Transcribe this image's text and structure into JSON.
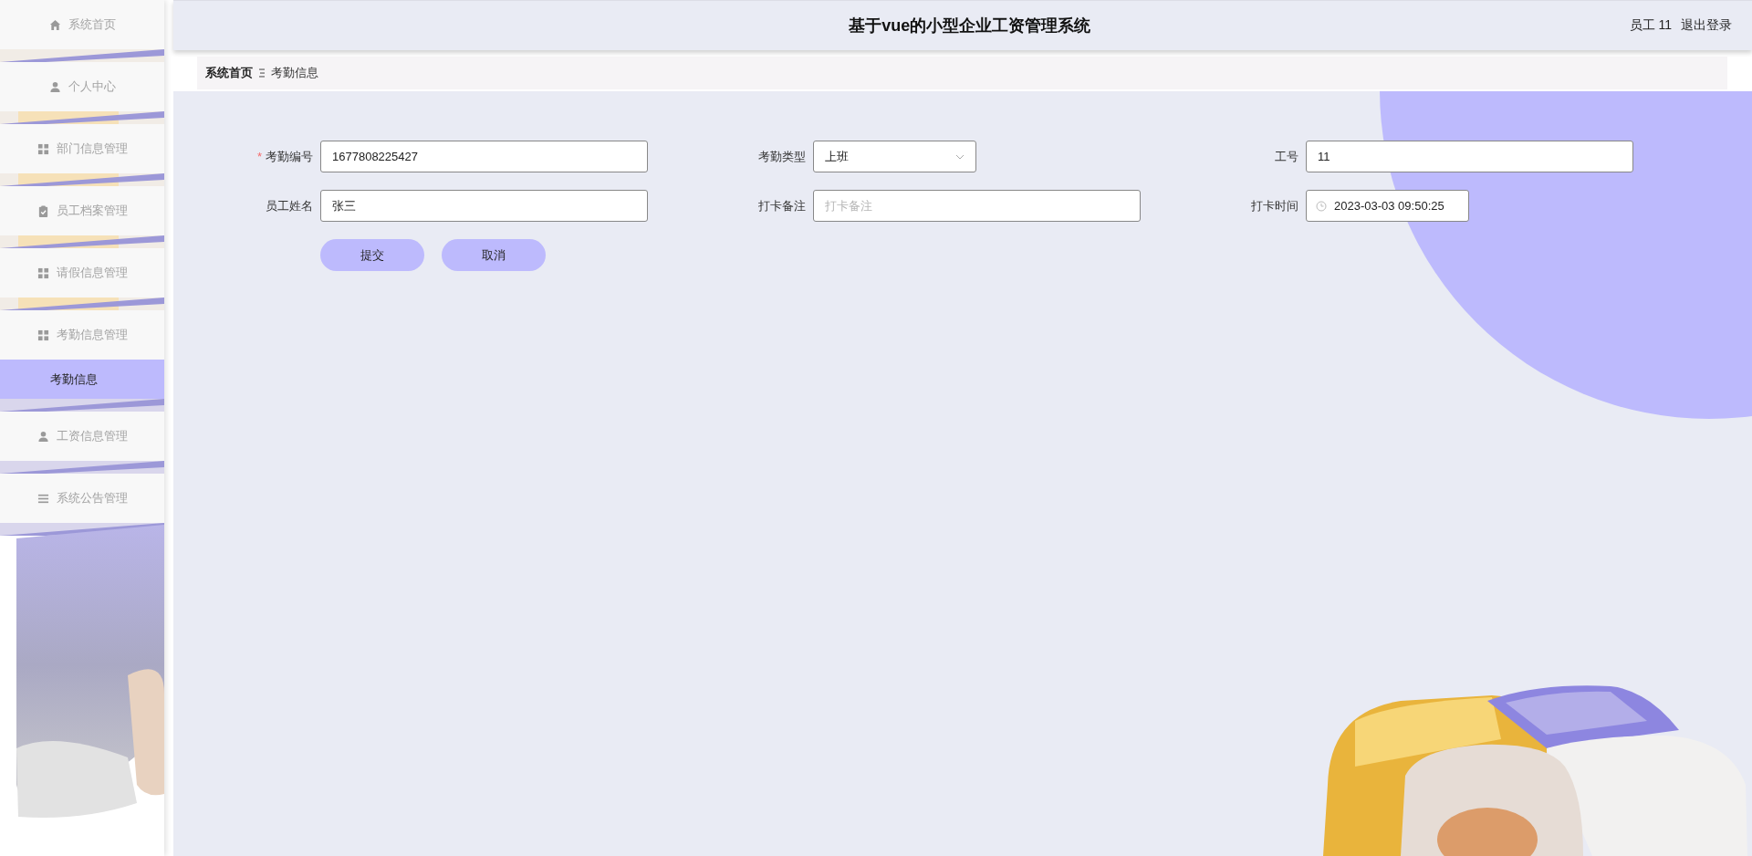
{
  "sidebar": {
    "items": [
      {
        "label": "系统首页",
        "kind": "home",
        "selected": false
      },
      {
        "label": "个人中心",
        "kind": "person",
        "selected": false
      },
      {
        "label": "部门信息管理",
        "kind": "grid",
        "selected": false
      },
      {
        "label": "员工档案管理",
        "kind": "clipboard",
        "selected": false
      },
      {
        "label": "请假信息管理",
        "kind": "grid",
        "selected": false
      },
      {
        "label": "考勤信息管理",
        "kind": "grid",
        "selected": false,
        "expanded": true,
        "children": [
          {
            "label": "考勤信息",
            "selected": true
          }
        ]
      },
      {
        "label": "工资信息管理",
        "kind": "person",
        "selected": false
      },
      {
        "label": "系统公告管理",
        "kind": "list",
        "selected": false
      }
    ]
  },
  "header": {
    "title": "基于vue的小型企业工资管理系统",
    "user": "员工 11",
    "logout": "退出登录"
  },
  "breadcrumb": [
    "系统首页",
    "考勤信息"
  ],
  "form": {
    "required_mark": "*",
    "fields": [
      {
        "label": "考勤编号",
        "required": true,
        "kind": "text",
        "value": "1677808225427"
      },
      {
        "label": "考勤类型",
        "required": false,
        "kind": "select",
        "value": "上班"
      },
      {
        "label": "工号",
        "required": false,
        "kind": "text",
        "value": "11"
      },
      {
        "label": "员工姓名",
        "required": false,
        "kind": "text",
        "value": "张三"
      },
      {
        "label": "打卡备注",
        "required": false,
        "kind": "text",
        "placeholder": "打卡备注"
      },
      {
        "label": "打卡时间",
        "required": false,
        "kind": "datetime",
        "value": "2023-03-03 09:50:25"
      }
    ],
    "buttons": [
      "提交",
      "取消"
    ]
  }
}
